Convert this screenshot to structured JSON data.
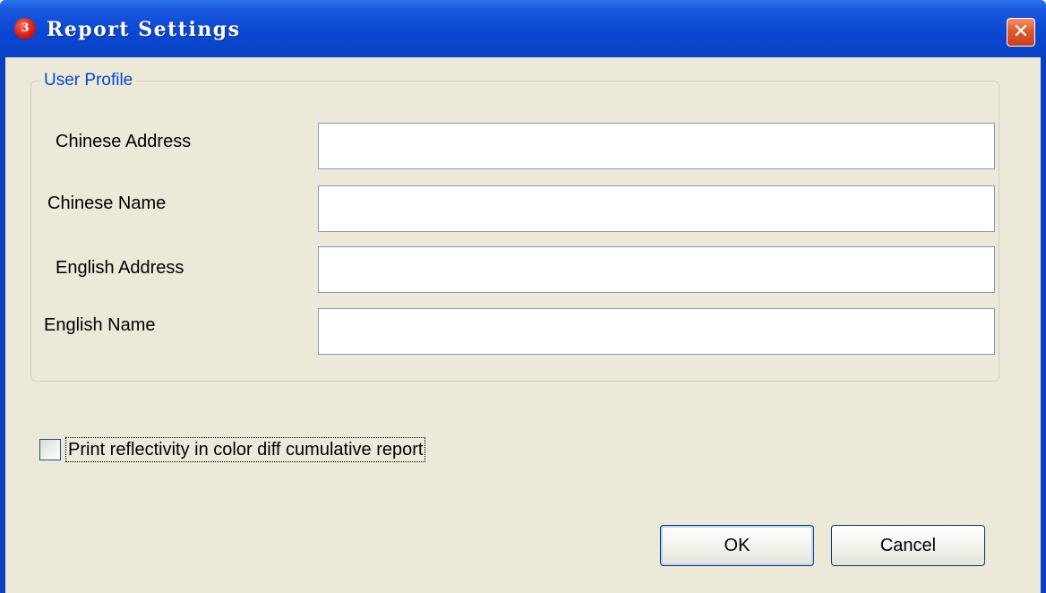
{
  "window": {
    "title": "Report Settings",
    "icon": "app-logo-icon",
    "close_icon": "close-icon",
    "close_glyph": "✕"
  },
  "profile": {
    "legend": "User Profile",
    "fields": [
      {
        "label": "Chinese Address",
        "value": "",
        "placeholder": ""
      },
      {
        "label": "Chinese Name",
        "value": "",
        "placeholder": ""
      },
      {
        "label": "English Address",
        "value": "",
        "placeholder": ""
      },
      {
        "label": "English Name",
        "value": "",
        "placeholder": ""
      }
    ]
  },
  "options": {
    "print_reflectivity_label": "Print reflectivity in color diff cumulative report",
    "print_reflectivity_checked": false
  },
  "buttons": {
    "ok": "OK",
    "cancel": "Cancel"
  },
  "colors": {
    "title_bar": "#0a46d1",
    "client_bg": "#ece9d8",
    "legend_text": "#0046d5",
    "close_button": "#e05a2c"
  }
}
